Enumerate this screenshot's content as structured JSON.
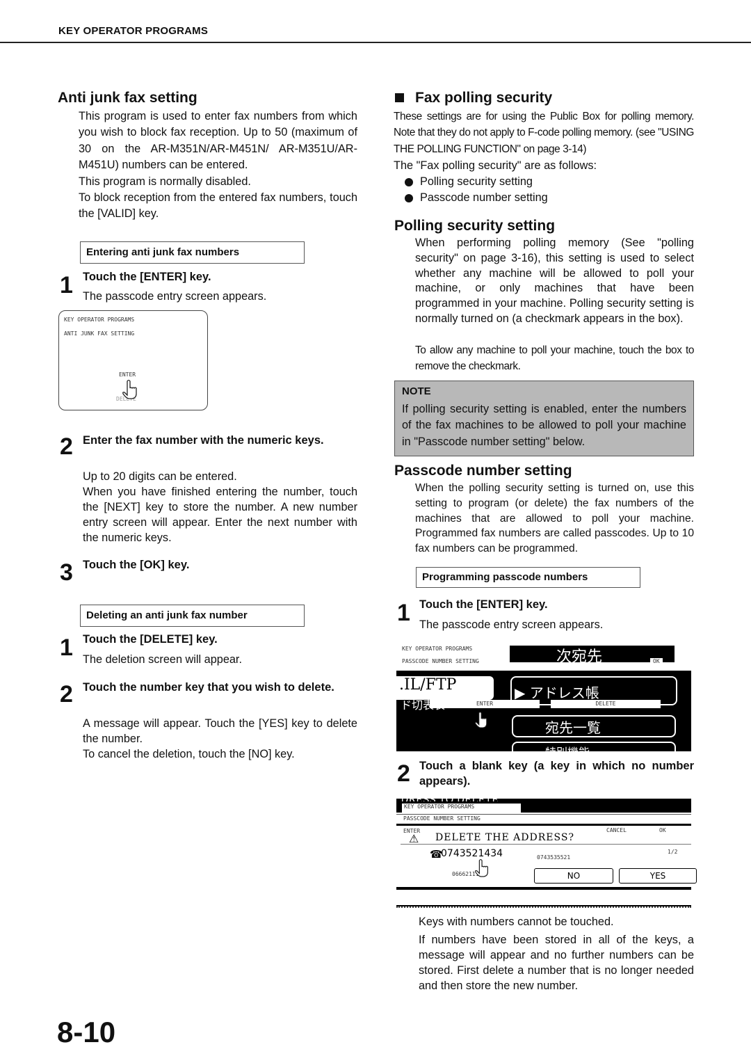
{
  "header": {
    "section": "KEY OPERATOR PROGRAMS"
  },
  "left": {
    "title": "Anti junk fax setting",
    "intro": [
      "This program is used to enter fax numbers from which you wish to block fax reception. Up to 50 (maximum of 30 on the AR-M351N/AR-M451N/ AR-M351U/AR-M451U) numbers can be entered.",
      "This program is normally disabled.",
      "To block reception from the entered fax numbers, touch the [VALID] key."
    ],
    "entering": {
      "label": "Entering anti junk fax numbers",
      "steps": [
        {
          "num": "1",
          "title": "Touch the [ENTER] key.",
          "body": [
            "The passcode entry screen appears."
          ]
        },
        {
          "num": "2",
          "title": "Enter the fax number with the numeric keys.",
          "body": [
            "Up to 20 digits can be entered.",
            "When you have finished entering the number, touch the [NEXT] key to store the number. A new number entry screen will appear. Enter the next number with the numeric keys."
          ]
        },
        {
          "num": "3",
          "title": "Touch the [OK] key.",
          "body": []
        }
      ],
      "screen": {
        "line1": "KEY OPERATOR PROGRAMS",
        "line2": "ANTI JUNK FAX SETTING",
        "enter": "ENTER",
        "delete": "DELETE"
      }
    },
    "deleting": {
      "label": "Deleting an anti junk fax number",
      "steps": [
        {
          "num": "1",
          "title": "Touch the [DELETE] key.",
          "body": [
            "The deletion screen will appear."
          ]
        },
        {
          "num": "2",
          "title": "Touch the number key that you wish to delete.",
          "body": [
            "A message will appear. Touch the [YES] key to delete the number.",
            "To cancel the deletion, touch the [NO] key."
          ]
        }
      ]
    }
  },
  "right": {
    "fax_polling": {
      "title": "Fax polling security",
      "intro": "These settings are for using the Public Box for polling memory. Note that they do not apply to F-code polling memory. (see \"USING THE POLLING FUNCTION\" on page 3-14)",
      "lead": "The \"Fax polling security\" are as follows:",
      "bullets": [
        "Polling security setting",
        "Passcode number setting"
      ]
    },
    "polling_security": {
      "title": "Polling security setting",
      "body": "When performing polling memory (See \"polling security\" on page 3-16), this setting is used to select whether any machine will be allowed to poll your machine, or only machines that have been programmed in your machine. Polling security setting is normally turned on (a checkmark appears in the box).",
      "body2": "To allow any machine to poll your machine, touch the box to remove the checkmark."
    },
    "note": {
      "title": "NOTE",
      "body": "If polling security setting is enabled, enter the numbers of the fax machines to be allowed to poll your machine in \"Passcode number setting\" below."
    },
    "passcode": {
      "title": "Passcode number setting",
      "body": "When the polling security setting is turned on, use this setting to program (or delete) the fax numbers of the machines that are allowed to poll your machine. Programmed fax numbers are called passcodes. Up to 10 fax numbers can be programmed.",
      "label": "Programming passcode numbers",
      "steps": [
        {
          "num": "1",
          "title": "Touch the [ENTER] key.",
          "body": "The passcode entry screen appears."
        },
        {
          "num": "2",
          "title": "Touch a blank key (a key in which no number appears).",
          "body": ""
        }
      ],
      "screen1": {
        "line1": "KEY OPERATOR PROGRAMS",
        "line2": "PASSCODE NUMBER SETTING",
        "ok": "OK",
        "enter": "ENTER",
        "delete": "DELETE",
        "jp_next": "次宛先",
        "jp_email": ".IL/FTP",
        "jp_key": "ド切表表",
        "jp_address": "▶ アドレス帳",
        "jp_list": "宛先一覧",
        "jp_special": "特別機能"
      },
      "screen2": {
        "top": "DRESS TO DELETE.",
        "line1": "KEY OPERATOR PROGRAMS",
        "line2": "PASSCODE NUMBER SETTING",
        "enter": "ENTER",
        "cancel": "CANCEL",
        "ok": "OK",
        "message": "DELETE THE ADDRESS?",
        "number1": "0743521434",
        "number2": "0743535521",
        "number3": "0666211111",
        "page": "1/2",
        "no": "NO",
        "yes": "YES"
      },
      "after": [
        "Keys with numbers cannot be touched.",
        "If numbers have been stored in all of the keys, a message will appear and no further numbers can be stored. First delete a number that is no longer needed and then store the new number."
      ]
    }
  },
  "footer": {
    "page": "8-10"
  }
}
